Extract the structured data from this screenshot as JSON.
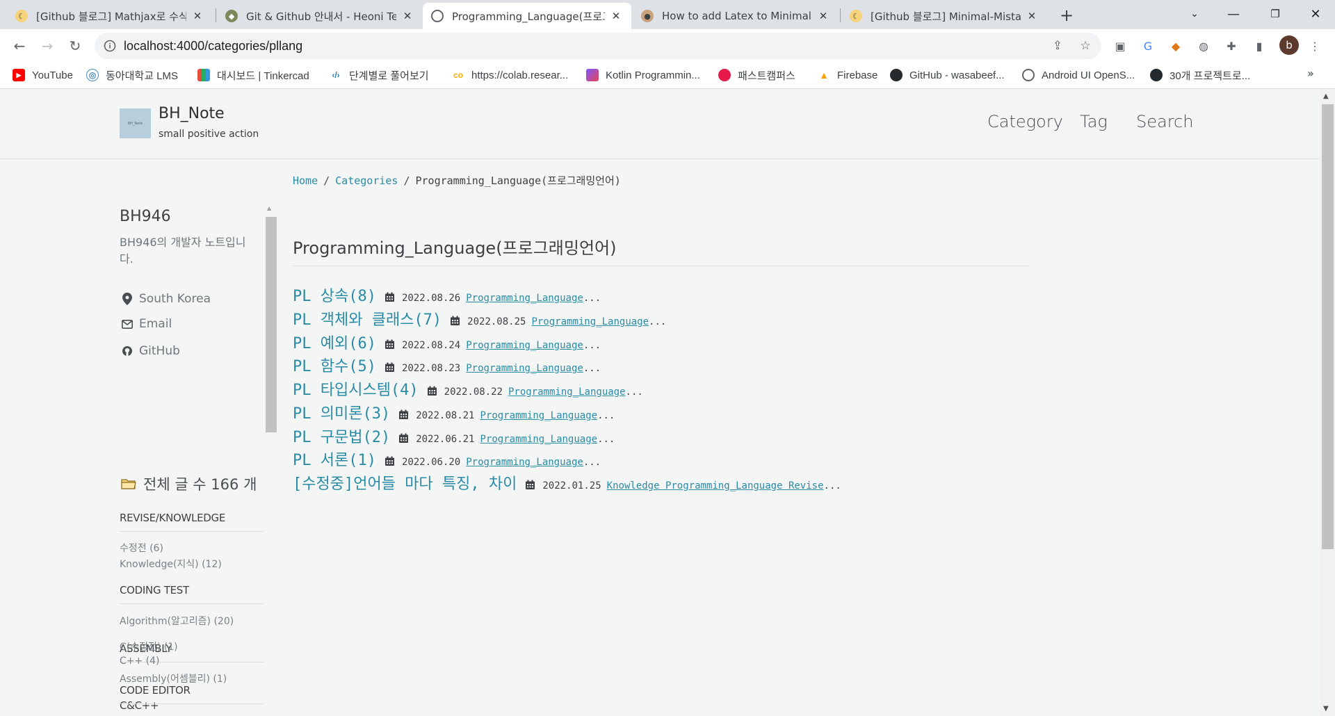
{
  "browser": {
    "tabs": [
      {
        "title": "[Github 블로그] Mathjax로 수식",
        "favicon": "moon"
      },
      {
        "title": "Git & Github 안내서 - Heoni Te",
        "favicon": "octocat"
      },
      {
        "title": "Programming_Language(프로그",
        "favicon": "globe"
      },
      {
        "title": "How to add Latex to Minimal M",
        "favicon": "face"
      },
      {
        "title": "[Github 블로그] Minimal-Mistak",
        "favicon": "moon"
      }
    ],
    "url": "localhost:4000/categories/pllang",
    "profile_initial": "b",
    "bookmarks": [
      {
        "label": "YouTube",
        "icon": "youtube-icon"
      },
      {
        "label": "동아대학교 LMS",
        "icon": "lms-icon"
      },
      {
        "label": "대시보드 | Tinkercad",
        "icon": "tinkercad-icon"
      },
      {
        "label": "단계별로 풀어보기",
        "icon": "code-icon"
      },
      {
        "label": "https://colab.resear...",
        "icon": "colab-icon"
      },
      {
        "label": "Kotlin Programmin...",
        "icon": "kotlin-icon"
      },
      {
        "label": "패스트캠퍼스",
        "icon": "fastcampus-icon"
      },
      {
        "label": "Firebase",
        "icon": "firebase-icon"
      },
      {
        "label": "GitHub - wasabeef...",
        "icon": "github-icon"
      },
      {
        "label": "Android UI OpenS...",
        "icon": "globe-icon"
      },
      {
        "label": "30개 프로젝트로...",
        "icon": "github-icon"
      }
    ]
  },
  "site": {
    "title": "BH_Note",
    "subtitle": "small positive action",
    "logo_text": "BH_Note",
    "nav": [
      "Category",
      "Tag",
      "Search"
    ]
  },
  "breadcrumb": {
    "home": "Home",
    "categories": "Categories",
    "current": "Programming_Language(프로그래밍언어)",
    "separator": "/"
  },
  "sidebar": {
    "author": "BH946",
    "bio": "BH946의 개발자 노트입니다.",
    "links": [
      {
        "label": "South Korea",
        "icon": "map-marker-icon"
      },
      {
        "label": "Email",
        "icon": "envelope-icon"
      },
      {
        "label": "GitHub",
        "icon": "github-icon"
      }
    ],
    "total_posts": "전체 글 수 166 개",
    "categories": [
      {
        "heading": "REVISE/KNOWLEDGE",
        "items": [
          "수정전 (6)",
          "Knowledge(지식) (12)"
        ]
      },
      {
        "heading": "CODING TEST",
        "items": [
          "Algorithm(알고리즘) (20)"
        ]
      },
      {
        "heading": "ASSEMBLY",
        "items": [
          "Assembly(어셈블리) (1)"
        ]
      },
      {
        "heading": "C&C++",
        "items": [
          "C(수정전) (1)",
          "C++ (4)"
        ]
      },
      {
        "heading": "CODE EDITOR",
        "items": []
      }
    ]
  },
  "main": {
    "title": "Programming_Language(프로그래밍언어)",
    "posts": [
      {
        "title": "PL 상속(8)",
        "date": "2022.08.26",
        "tags": "Programming_Language ",
        "ellipsis": "..."
      },
      {
        "title": "PL 객체와 클래스(7)",
        "date": "2022.08.25",
        "tags": "Programming_Language ",
        "ellipsis": "..."
      },
      {
        "title": "PL 예외(6)",
        "date": "2022.08.24",
        "tags": "Programming_Language ",
        "ellipsis": "..."
      },
      {
        "title": "PL 함수(5)",
        "date": "2022.08.23",
        "tags": "Programming_Language ",
        "ellipsis": "..."
      },
      {
        "title": "PL 타입시스템(4)",
        "date": "2022.08.22",
        "tags": "Programming_Language ",
        "ellipsis": "..."
      },
      {
        "title": "PL 의미론(3)",
        "date": "2022.08.21",
        "tags": "Programming_Language ",
        "ellipsis": "..."
      },
      {
        "title": "PL 구문법(2)",
        "date": "2022.06.21",
        "tags": "Programming_Language ",
        "ellipsis": "..."
      },
      {
        "title": "PL 서론(1)",
        "date": "2022.06.20",
        "tags": "Programming_Language ",
        "ellipsis": "..."
      },
      {
        "title": "[수정중]언어들 마다 특징, 차이",
        "date": "2022.01.25",
        "tags": "Knowledge Programming_Language Revise ",
        "ellipsis": "..."
      }
    ]
  },
  "colors": {
    "link": "#2a8ba5",
    "text": "#3d4144",
    "muted": "#7a8288",
    "page_bg": "#f4f5f5"
  }
}
